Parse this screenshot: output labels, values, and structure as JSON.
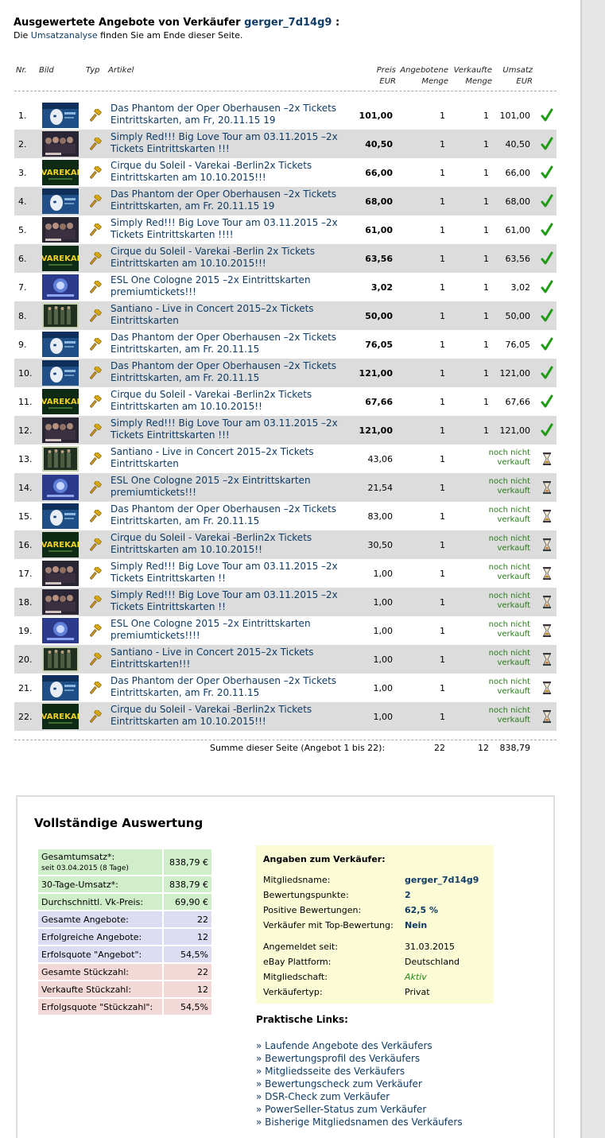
{
  "heading": {
    "prefix": "Ausgewertete Angebote von Verkäufer",
    "seller": "gerger_7d14g9",
    "suffix": ":"
  },
  "subline": {
    "pre": "Die",
    "link": "Umsatzanalyse",
    "post": "finden Sie am Ende dieser Seite."
  },
  "columns": {
    "nr": "Nr.",
    "bild": "Bild",
    "typ": "Typ",
    "artikel": "Artikel",
    "preis1": "Preis",
    "preis2": "EUR",
    "angeb1": "Angebotene",
    "angeb2": "Menge",
    "verk1": "Verkaufte",
    "verk2": "Menge",
    "ums1": "Umsatz",
    "ums2": "EUR"
  },
  "rows": [
    {
      "nr": "1.",
      "img": "phantom",
      "title": "Das Phantom der Oper Oberhausen –2x Tickets Eintrittskarten, am Fr, 20.11.15 19",
      "price": "101,00",
      "qty": "1",
      "sold": "1",
      "umsatz": "101,00",
      "status": "sold"
    },
    {
      "nr": "2.",
      "img": "simplyred",
      "title": "Simply Red!!! Big Love Tour am 03.11.2015 –2x Tickets Eintrittskarten !!!",
      "price": "40,50",
      "qty": "1",
      "sold": "1",
      "umsatz": "40,50",
      "status": "sold"
    },
    {
      "nr": "3.",
      "img": "varekai",
      "title": "Cirque du Soleil - Varekai -Berlin2x Tickets Eintrittskarten am 10.10.2015!!!",
      "price": "66,00",
      "qty": "1",
      "sold": "1",
      "umsatz": "66,00",
      "status": "sold"
    },
    {
      "nr": "4.",
      "img": "phantom",
      "title": "Das Phantom der Oper Oberhausen –2x Tickets Eintrittskarten, am Fr. 20.11.15 19",
      "price": "68,00",
      "qty": "1",
      "sold": "1",
      "umsatz": "68,00",
      "status": "sold"
    },
    {
      "nr": "5.",
      "img": "simplyred",
      "title": "Simply Red!!! Big Love Tour am 03.11.2015 –2x Tickets Eintrittskarten !!!!",
      "price": "61,00",
      "qty": "1",
      "sold": "1",
      "umsatz": "61,00",
      "status": "sold"
    },
    {
      "nr": "6.",
      "img": "varekai",
      "title": "Cirque du Soleil - Varekai -Berlin 2x Tickets Eintrittskarten am 10.10.2015!!!",
      "price": "63,56",
      "qty": "1",
      "sold": "1",
      "umsatz": "63,56",
      "status": "sold"
    },
    {
      "nr": "7.",
      "img": "esl",
      "title": "ESL One Cologne 2015 –2x Eintrittskarten premiumtickets!!!",
      "price": "3,02",
      "qty": "1",
      "sold": "1",
      "umsatz": "3,02",
      "status": "sold"
    },
    {
      "nr": "8.",
      "img": "santiano",
      "title": "Santiano - Live in Concert 2015–2x Tickets Eintrittskarten",
      "price": "50,00",
      "qty": "1",
      "sold": "1",
      "umsatz": "50,00",
      "status": "sold"
    },
    {
      "nr": "9.",
      "img": "phantom",
      "title": "Das Phantom der Oper Oberhausen –2x Tickets Eintrittskarten, am Fr. 20.11.15",
      "price": "76,05",
      "qty": "1",
      "sold": "1",
      "umsatz": "76,05",
      "status": "sold"
    },
    {
      "nr": "10.",
      "img": "phantom",
      "title": "Das Phantom der Oper Oberhausen –2x Tickets Eintrittskarten, am Fr. 20.11.15",
      "price": "121,00",
      "qty": "1",
      "sold": "1",
      "umsatz": "121,00",
      "status": "sold"
    },
    {
      "nr": "11.",
      "img": "varekai",
      "title": "Cirque du Soleil - Varekai -Berlin2x Tickets Eintrittskarten am 10.10.2015!!",
      "price": "67,66",
      "qty": "1",
      "sold": "1",
      "umsatz": "67,66",
      "status": "sold"
    },
    {
      "nr": "12.",
      "img": "simplyred",
      "title": "Simply Red!!! Big Love Tour am 03.11.2015 –2x Tickets Eintrittskarten !!!",
      "price": "121,00",
      "qty": "1",
      "sold": "1",
      "umsatz": "121,00",
      "status": "sold"
    },
    {
      "nr": "13.",
      "img": "santiano",
      "title": "Santiano - Live in Concert 2015–2x Tickets Eintrittskarten",
      "price": "43,06",
      "qty": "1",
      "sold": "",
      "umsatz": "",
      "status": "open"
    },
    {
      "nr": "14.",
      "img": "esl",
      "title": "ESL One Cologne 2015 –2x Eintrittskarten premiumtickets!!!",
      "price": "21,54",
      "qty": "1",
      "sold": "",
      "umsatz": "",
      "status": "open"
    },
    {
      "nr": "15.",
      "img": "phantom",
      "title": "Das Phantom der Oper Oberhausen –2x Tickets Eintrittskarten, am Fr. 20.11.15",
      "price": "83,00",
      "qty": "1",
      "sold": "",
      "umsatz": "",
      "status": "open"
    },
    {
      "nr": "16.",
      "img": "varekai",
      "title": "Cirque du Soleil - Varekai -Berlin2x Tickets Eintrittskarten am 10.10.2015!!",
      "price": "30,50",
      "qty": "1",
      "sold": "",
      "umsatz": "",
      "status": "open"
    },
    {
      "nr": "17.",
      "img": "simplyred",
      "title": "Simply Red!!! Big Love Tour am 03.11.2015 –2x Tickets Eintrittskarten !!",
      "price": "1,00",
      "qty": "1",
      "sold": "",
      "umsatz": "",
      "status": "open"
    },
    {
      "nr": "18.",
      "img": "simplyred",
      "title": "Simply Red!!! Big Love Tour am 03.11.2015 –2x Tickets Eintrittskarten !!",
      "price": "1,00",
      "qty": "1",
      "sold": "",
      "umsatz": "",
      "status": "open"
    },
    {
      "nr": "19.",
      "img": "esl",
      "title": "ESL One Cologne 2015 –2x Eintrittskarten premiumtickets!!!!",
      "price": "1,00",
      "qty": "1",
      "sold": "",
      "umsatz": "",
      "status": "open"
    },
    {
      "nr": "20.",
      "img": "santiano",
      "title": "Santiano - Live in Concert 2015–2x Tickets Eintrittskarten!!!",
      "price": "1,00",
      "qty": "1",
      "sold": "",
      "umsatz": "",
      "status": "open"
    },
    {
      "nr": "21.",
      "img": "phantom",
      "title": "Das Phantom der Oper Oberhausen –2x Tickets Eintrittskarten, am Fr. 20.11.15",
      "price": "1,00",
      "qty": "1",
      "sold": "",
      "umsatz": "",
      "status": "open"
    },
    {
      "nr": "22.",
      "img": "varekai",
      "title": "Cirque du Soleil - Varekai -Berlin2x Tickets Eintrittskarten am 10.10.2015!!!",
      "price": "1,00",
      "qty": "1",
      "sold": "",
      "umsatz": "",
      "status": "open"
    }
  ],
  "not_sold": [
    "noch nicht",
    "verkauft"
  ],
  "sum": {
    "label": "Summe dieser Seite (Angebot 1 bis 22):",
    "qty": "22",
    "sold": "12",
    "umsatz": "838,79"
  },
  "auswertung": {
    "title": "Vollständige Auswertung",
    "stats": [
      {
        "label": "Gesamtumsatz*:",
        "sub": "seit 03.04.2015 (8 Tage)",
        "value": "838,79 €",
        "group": "g"
      },
      {
        "label": "30-Tage-Umsatz*:",
        "sub": "",
        "value": "838,79 €",
        "group": "g"
      },
      {
        "label": "Durchschnittl. Vk-Preis:",
        "sub": "",
        "value": "69,90 €",
        "group": "g"
      },
      {
        "label": "Gesamte Angebote:",
        "sub": "",
        "value": "22",
        "group": "bl"
      },
      {
        "label": "Erfolgreiche Angebote:",
        "sub": "",
        "value": "12",
        "group": "bl"
      },
      {
        "label": "Erfolsquote \"Angebot\":",
        "sub": "",
        "value": "54,5%",
        "group": "bl"
      },
      {
        "label": "Gesamte Stückzahl:",
        "sub": "",
        "value": "22",
        "group": "r"
      },
      {
        "label": "Verkaufte Stückzahl:",
        "sub": "",
        "value": "12",
        "group": "r"
      },
      {
        "label": "Erfolgsquote \"Stückzahl\":",
        "sub": "",
        "value": "54,5%",
        "group": "r"
      }
    ],
    "seller_title": "Angaben zum Verkäufer:",
    "seller": [
      {
        "label": "Mitgliedsname:",
        "value": "gerger_7d14g9",
        "style": "bold-blue"
      },
      {
        "label": "Bewertungspunkte:",
        "value": "2",
        "style": "bold-blue"
      },
      {
        "label": "Positive Bewertungen:",
        "value": "62,5 %",
        "style": "bold-blue"
      },
      {
        "label": "Verkäufer mit Top-Bewertung:",
        "value": "Nein",
        "style": "bold-blue"
      },
      {
        "label": "Angemeldet seit:",
        "value": "31.03.2015",
        "style": "plain"
      },
      {
        "label": "eBay Plattform:",
        "value": "Deutschland",
        "style": "plain"
      },
      {
        "label": "Mitgliedschaft:",
        "value": "Aktiv",
        "style": "green-italic"
      },
      {
        "label": "Verkäufertyp:",
        "value": "Privat",
        "style": "plain"
      }
    ],
    "links_title": "Praktische Links:",
    "links": [
      "» Laufende Angebote des Verkäufers",
      "» Bewertungsprofil des Verkäufers",
      "» Mitgliedsseite des Verkäufers",
      "» Bewertungscheck zum Verkäufer",
      "» DSR-Check zum Verkäufer",
      "» PowerSeller-Status zum Verkäufer",
      "» Bisherige Mitgliedsnamen des Verkäufers"
    ]
  },
  "colors": {
    "link": "#0f3c66",
    "sold": "#1f9a14",
    "open": "#8a5a00",
    "alt_row": "#dcdcdc"
  }
}
